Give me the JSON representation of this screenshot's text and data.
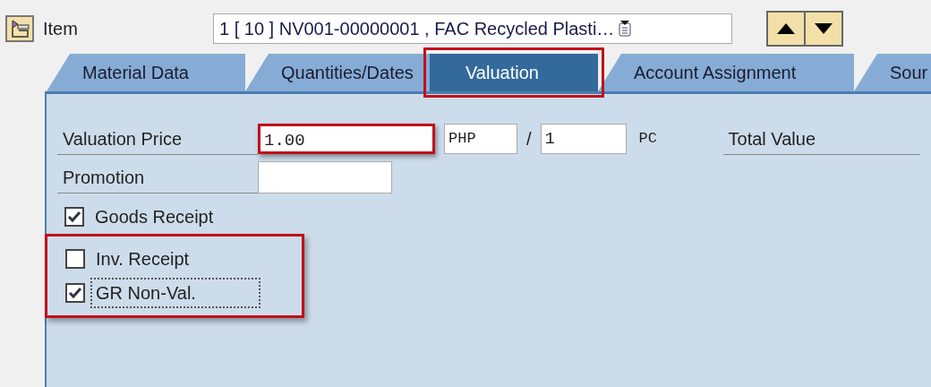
{
  "header": {
    "label": "Item",
    "value": "1 [ 10 ] NV001-00000001 , FAC Recycled Plasti…"
  },
  "tabs": [
    {
      "label": "Material Data",
      "selected": false,
      "highlighted": false
    },
    {
      "label": "Quantities/Dates",
      "selected": false,
      "highlighted": false
    },
    {
      "label": "Valuation",
      "selected": true,
      "highlighted": true
    },
    {
      "label": "Account Assignment",
      "selected": false,
      "highlighted": false
    },
    {
      "label": "Sour",
      "selected": false,
      "highlighted": false
    }
  ],
  "price": {
    "label": "Valuation Price",
    "value": "1.00",
    "highlighted": true,
    "currency": "PHP",
    "separator": "/",
    "quantity": "1",
    "unit": "PC",
    "total_label": "Total Value"
  },
  "promotion": {
    "label": "Promotion"
  },
  "checkboxes": [
    {
      "label": "Goods Receipt",
      "checked": true,
      "focused": false,
      "highlighted": false
    },
    {
      "label": "Inv. Receipt",
      "checked": false,
      "focused": false,
      "highlighted": true
    },
    {
      "label": "GR Non-Val.",
      "checked": true,
      "focused": true,
      "highlighted": true
    }
  ]
}
